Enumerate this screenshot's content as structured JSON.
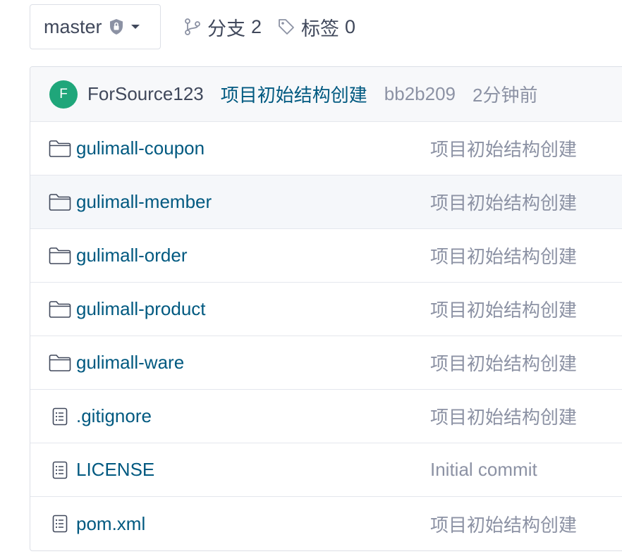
{
  "branch": {
    "name": "master",
    "protected_icon": "shield-lock-icon",
    "dropdown_icon": "caret-down-icon"
  },
  "meta": {
    "branches": {
      "label": "分支",
      "count": "2",
      "icon": "branch-icon"
    },
    "tags": {
      "label": "标签",
      "count": "0",
      "icon": "tag-icon"
    }
  },
  "commit": {
    "avatar_letter": "F",
    "avatar_color": "#1fa67a",
    "author": "ForSource123",
    "message": "项目初始结构创建",
    "sha": "bb2b209",
    "time": "2分钟前"
  },
  "files": [
    {
      "name": "gulimall-coupon",
      "type": "folder",
      "commit": "项目初始结构创建"
    },
    {
      "name": "gulimall-member",
      "type": "folder",
      "commit": "项目初始结构创建"
    },
    {
      "name": "gulimall-order",
      "type": "folder",
      "commit": "项目初始结构创建"
    },
    {
      "name": "gulimall-product",
      "type": "folder",
      "commit": "项目初始结构创建"
    },
    {
      "name": "gulimall-ware",
      "type": "folder",
      "commit": "项目初始结构创建"
    },
    {
      "name": ".gitignore",
      "type": "file",
      "commit": "项目初始结构创建"
    },
    {
      "name": "LICENSE",
      "type": "file",
      "commit": "Initial commit"
    },
    {
      "name": "pom.xml",
      "type": "file",
      "commit": "项目初始结构创建"
    }
  ],
  "colors": {
    "link": "#005980",
    "muted": "#8c92a4",
    "text": "#40485b",
    "border": "#dcdfe6"
  }
}
